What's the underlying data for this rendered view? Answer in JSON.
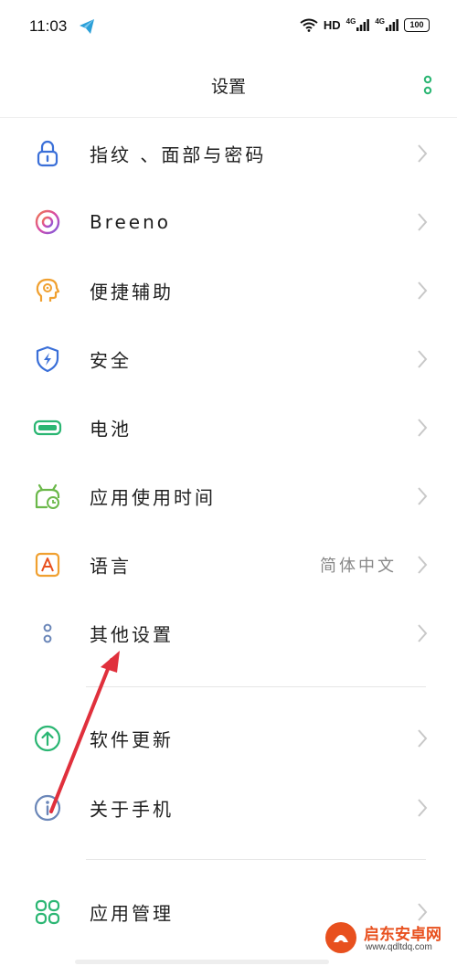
{
  "status_bar": {
    "time": "11:03",
    "network_label": "HD",
    "signal_1": "4G",
    "signal_2": "4G",
    "battery": "100"
  },
  "header": {
    "title": "设置",
    "more_icon": "vertical-dots-icon"
  },
  "colors": {
    "accent_green": "#2bb673",
    "chevron": "#c8c8c8",
    "arrow": "#e0303c"
  },
  "settings": {
    "items": [
      {
        "label": "指纹 、面部与密码",
        "icon": "lock-icon"
      },
      {
        "label": "Breeno",
        "icon": "breeno-icon"
      },
      {
        "label": "便捷辅助",
        "icon": "assist-head-icon"
      },
      {
        "label": "安全",
        "icon": "shield-icon"
      },
      {
        "label": "电池",
        "icon": "battery-icon"
      },
      {
        "label": "应用使用时间",
        "icon": "app-time-icon"
      },
      {
        "label": "语言",
        "icon": "language-icon",
        "value": "简体中文"
      },
      {
        "label": "其他设置",
        "icon": "dots-icon"
      },
      {
        "label": "软件更新",
        "icon": "update-icon"
      },
      {
        "label": "关于手机",
        "icon": "info-icon"
      },
      {
        "label": "应用管理",
        "icon": "app-grid-icon"
      }
    ]
  },
  "watermark": {
    "title": "启东安卓网",
    "url": "www.qdltdq.com"
  }
}
